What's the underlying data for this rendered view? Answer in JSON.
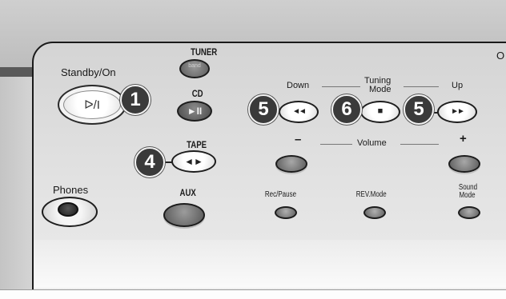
{
  "colors": {
    "panel_top": "#c9c9c9",
    "panel_face": "#dcdcdc",
    "panel_bottom": "#efefef",
    "button_dark": "#6e6e6e",
    "button_light": "#f7f7f7",
    "callout": "#3a3a3a"
  },
  "corner_label": "O",
  "standby": {
    "label": "Standby/On",
    "glyph": "ᐅ/I"
  },
  "tuner": {
    "label": "TUNER",
    "sub": "band"
  },
  "cd": {
    "label": "CD",
    "glyph": "►II"
  },
  "tape": {
    "label": "TAPE",
    "glyph": "◄►"
  },
  "aux": {
    "label": "AUX"
  },
  "phones": {
    "label": "Phones"
  },
  "tuning": {
    "down_label": "Down",
    "mode_line1": "Tuning",
    "mode_line2": "Mode",
    "up_label": "Up",
    "down_glyph": "◄◄",
    "stop_glyph": "■",
    "up_glyph": "►►"
  },
  "volume": {
    "label": "Volume",
    "minus": "–",
    "plus": "+"
  },
  "rec_pause": {
    "label": "Rec/Pause"
  },
  "rev_mode": {
    "label": "REV.Mode"
  },
  "sound_mode": {
    "line1": "Sound",
    "line2": "Mode"
  },
  "callouts": {
    "c1": "1",
    "c4": "4",
    "c5a": "5",
    "c6": "6",
    "c5b": "5"
  }
}
